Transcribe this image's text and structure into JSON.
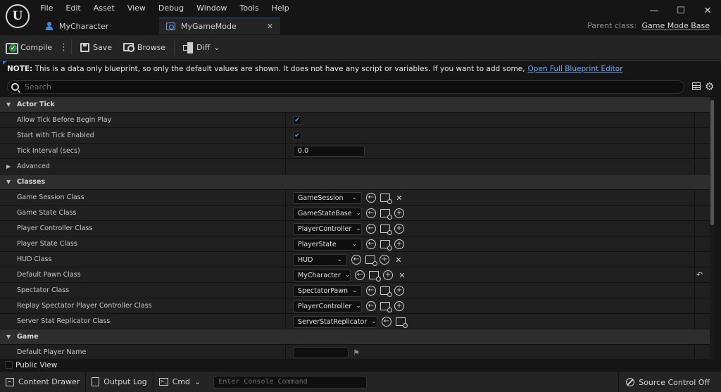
{
  "menu": [
    "File",
    "Edit",
    "Asset",
    "View",
    "Debug",
    "Window",
    "Tools",
    "Help"
  ],
  "tabs": [
    {
      "label": "MyCharacter",
      "icon": "person-icon",
      "active": false
    },
    {
      "label": "MyGameMode",
      "icon": "game-mode-icon",
      "active": true
    }
  ],
  "parent_class": {
    "label": "Parent class:",
    "value": "Game Mode Base"
  },
  "toolbar": {
    "compile": "Compile",
    "save": "Save",
    "browse": "Browse",
    "diff": "Diff"
  },
  "note": {
    "prefix": "NOTE:",
    "text": "This is a data only blueprint, so only the default values are shown.  It does not have any script or variables.  If you want to add some,",
    "link": "Open Full Blueprint Editor"
  },
  "search": {
    "placeholder": "Search"
  },
  "details": {
    "actor_tick": {
      "title": "Actor Tick",
      "allow_tick_before_begin_play": {
        "label": "Allow Tick Before Begin Play",
        "checked": true
      },
      "start_with_tick_enabled": {
        "label": "Start with Tick Enabled",
        "checked": true
      },
      "tick_interval": {
        "label": "Tick Interval (secs)",
        "value": "0.0"
      },
      "advanced": "Advanced"
    },
    "classes": {
      "title": "Classes",
      "rows": [
        {
          "label": "Game Session Class",
          "value": "GameSession"
        },
        {
          "label": "Game State Class",
          "value": "GameStateBase"
        },
        {
          "label": "Player Controller Class",
          "value": "PlayerController"
        },
        {
          "label": "Player State Class",
          "value": "PlayerState"
        },
        {
          "label": "HUD Class",
          "value": "HUD"
        },
        {
          "label": "Default Pawn Class",
          "value": "MyCharacter"
        },
        {
          "label": "Spectator Class",
          "value": "SpectatorPawn"
        },
        {
          "label": "Replay Spectator Player Controller Class",
          "value": "PlayerController"
        },
        {
          "label": "Server Stat Replicator Class",
          "value": "ServerStatReplicator"
        }
      ]
    },
    "game": {
      "title": "Game",
      "default_player_name": {
        "label": "Default Player Name",
        "value": ""
      }
    }
  },
  "public_view": "Public View",
  "status": {
    "content_drawer": "Content Drawer",
    "output_log": "Output Log",
    "cmd": "Cmd",
    "console_placeholder": "Enter Console Command",
    "source_control": "Source Control Off"
  },
  "colors": {
    "accent": "#2f7de0",
    "link": "#6fa8ff",
    "check": "#5aa0ff"
  }
}
